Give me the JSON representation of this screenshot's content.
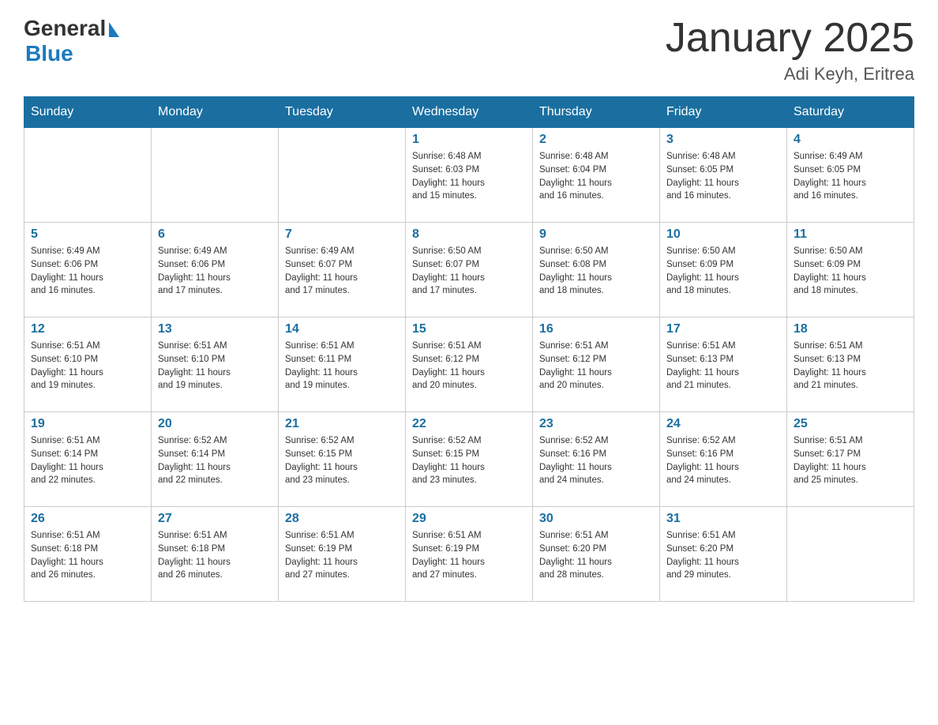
{
  "logo": {
    "general": "General",
    "blue": "Blue",
    "alt": "GeneralBlue Logo"
  },
  "title": "January 2025",
  "subtitle": "Adi Keyh, Eritrea",
  "weekdays": [
    "Sunday",
    "Monday",
    "Tuesday",
    "Wednesday",
    "Thursday",
    "Friday",
    "Saturday"
  ],
  "weeks": [
    [
      {
        "day": "",
        "info": ""
      },
      {
        "day": "",
        "info": ""
      },
      {
        "day": "",
        "info": ""
      },
      {
        "day": "1",
        "info": "Sunrise: 6:48 AM\nSunset: 6:03 PM\nDaylight: 11 hours\nand 15 minutes."
      },
      {
        "day": "2",
        "info": "Sunrise: 6:48 AM\nSunset: 6:04 PM\nDaylight: 11 hours\nand 16 minutes."
      },
      {
        "day": "3",
        "info": "Sunrise: 6:48 AM\nSunset: 6:05 PM\nDaylight: 11 hours\nand 16 minutes."
      },
      {
        "day": "4",
        "info": "Sunrise: 6:49 AM\nSunset: 6:05 PM\nDaylight: 11 hours\nand 16 minutes."
      }
    ],
    [
      {
        "day": "5",
        "info": "Sunrise: 6:49 AM\nSunset: 6:06 PM\nDaylight: 11 hours\nand 16 minutes."
      },
      {
        "day": "6",
        "info": "Sunrise: 6:49 AM\nSunset: 6:06 PM\nDaylight: 11 hours\nand 17 minutes."
      },
      {
        "day": "7",
        "info": "Sunrise: 6:49 AM\nSunset: 6:07 PM\nDaylight: 11 hours\nand 17 minutes."
      },
      {
        "day": "8",
        "info": "Sunrise: 6:50 AM\nSunset: 6:07 PM\nDaylight: 11 hours\nand 17 minutes."
      },
      {
        "day": "9",
        "info": "Sunrise: 6:50 AM\nSunset: 6:08 PM\nDaylight: 11 hours\nand 18 minutes."
      },
      {
        "day": "10",
        "info": "Sunrise: 6:50 AM\nSunset: 6:09 PM\nDaylight: 11 hours\nand 18 minutes."
      },
      {
        "day": "11",
        "info": "Sunrise: 6:50 AM\nSunset: 6:09 PM\nDaylight: 11 hours\nand 18 minutes."
      }
    ],
    [
      {
        "day": "12",
        "info": "Sunrise: 6:51 AM\nSunset: 6:10 PM\nDaylight: 11 hours\nand 19 minutes."
      },
      {
        "day": "13",
        "info": "Sunrise: 6:51 AM\nSunset: 6:10 PM\nDaylight: 11 hours\nand 19 minutes."
      },
      {
        "day": "14",
        "info": "Sunrise: 6:51 AM\nSunset: 6:11 PM\nDaylight: 11 hours\nand 19 minutes."
      },
      {
        "day": "15",
        "info": "Sunrise: 6:51 AM\nSunset: 6:12 PM\nDaylight: 11 hours\nand 20 minutes."
      },
      {
        "day": "16",
        "info": "Sunrise: 6:51 AM\nSunset: 6:12 PM\nDaylight: 11 hours\nand 20 minutes."
      },
      {
        "day": "17",
        "info": "Sunrise: 6:51 AM\nSunset: 6:13 PM\nDaylight: 11 hours\nand 21 minutes."
      },
      {
        "day": "18",
        "info": "Sunrise: 6:51 AM\nSunset: 6:13 PM\nDaylight: 11 hours\nand 21 minutes."
      }
    ],
    [
      {
        "day": "19",
        "info": "Sunrise: 6:51 AM\nSunset: 6:14 PM\nDaylight: 11 hours\nand 22 minutes."
      },
      {
        "day": "20",
        "info": "Sunrise: 6:52 AM\nSunset: 6:14 PM\nDaylight: 11 hours\nand 22 minutes."
      },
      {
        "day": "21",
        "info": "Sunrise: 6:52 AM\nSunset: 6:15 PM\nDaylight: 11 hours\nand 23 minutes."
      },
      {
        "day": "22",
        "info": "Sunrise: 6:52 AM\nSunset: 6:15 PM\nDaylight: 11 hours\nand 23 minutes."
      },
      {
        "day": "23",
        "info": "Sunrise: 6:52 AM\nSunset: 6:16 PM\nDaylight: 11 hours\nand 24 minutes."
      },
      {
        "day": "24",
        "info": "Sunrise: 6:52 AM\nSunset: 6:16 PM\nDaylight: 11 hours\nand 24 minutes."
      },
      {
        "day": "25",
        "info": "Sunrise: 6:51 AM\nSunset: 6:17 PM\nDaylight: 11 hours\nand 25 minutes."
      }
    ],
    [
      {
        "day": "26",
        "info": "Sunrise: 6:51 AM\nSunset: 6:18 PM\nDaylight: 11 hours\nand 26 minutes."
      },
      {
        "day": "27",
        "info": "Sunrise: 6:51 AM\nSunset: 6:18 PM\nDaylight: 11 hours\nand 26 minutes."
      },
      {
        "day": "28",
        "info": "Sunrise: 6:51 AM\nSunset: 6:19 PM\nDaylight: 11 hours\nand 27 minutes."
      },
      {
        "day": "29",
        "info": "Sunrise: 6:51 AM\nSunset: 6:19 PM\nDaylight: 11 hours\nand 27 minutes."
      },
      {
        "day": "30",
        "info": "Sunrise: 6:51 AM\nSunset: 6:20 PM\nDaylight: 11 hours\nand 28 minutes."
      },
      {
        "day": "31",
        "info": "Sunrise: 6:51 AM\nSunset: 6:20 PM\nDaylight: 11 hours\nand 29 minutes."
      },
      {
        "day": "",
        "info": ""
      }
    ]
  ]
}
